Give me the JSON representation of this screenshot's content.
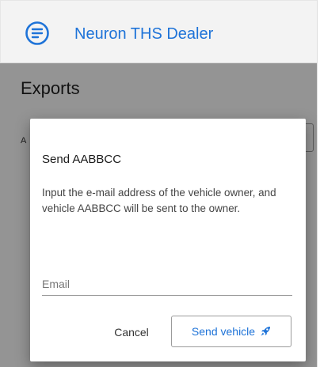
{
  "header": {
    "app_title": "Neuron THS Dealer",
    "logo_icon": "menu-lines-circle-icon"
  },
  "page": {
    "title": "Exports",
    "filter_label_fragment": "A"
  },
  "dialog": {
    "title": "Send AABBCC",
    "body": "Input the e-mail address of the vehicle owner, and vehicle AABBCC will be sent to the owner.",
    "email_placeholder": "Email",
    "email_value": "",
    "cancel_label": "Cancel",
    "send_label": "Send vehicle",
    "send_icon": "rocket-icon"
  },
  "colors": {
    "accent": "#1e73d8",
    "overlay": "rgba(0,0,0,0.42)",
    "header_bg": "#f3f3f3"
  }
}
